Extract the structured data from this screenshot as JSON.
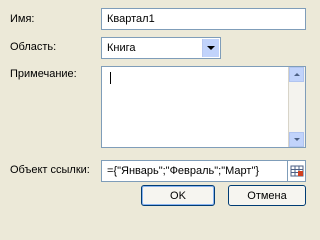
{
  "dialog": {
    "name_label": "Имя:",
    "name_value": "Квартал1",
    "scope_label": "Область:",
    "scope_value": "Книга",
    "comment_label": "Примечание:",
    "comment_value": "",
    "refers_to_label": "Объект ссылки:",
    "refers_to_value": "={\"Январь\";\"Февраль\";\"Март\"}",
    "ok_label": "OK",
    "cancel_label": "Отмена"
  },
  "icons": {
    "scope_dropdown": "chevron-down-icon",
    "scroll_up": "arrow-up-icon",
    "scroll_down": "arrow-down-icon",
    "range_picker": "range-select-icon"
  },
  "colors": {
    "dialog_background": "#ECE9D8",
    "field_border": "#7F9DB9",
    "scroll_button": "#C1D3FB",
    "button_border": "#003C74"
  }
}
